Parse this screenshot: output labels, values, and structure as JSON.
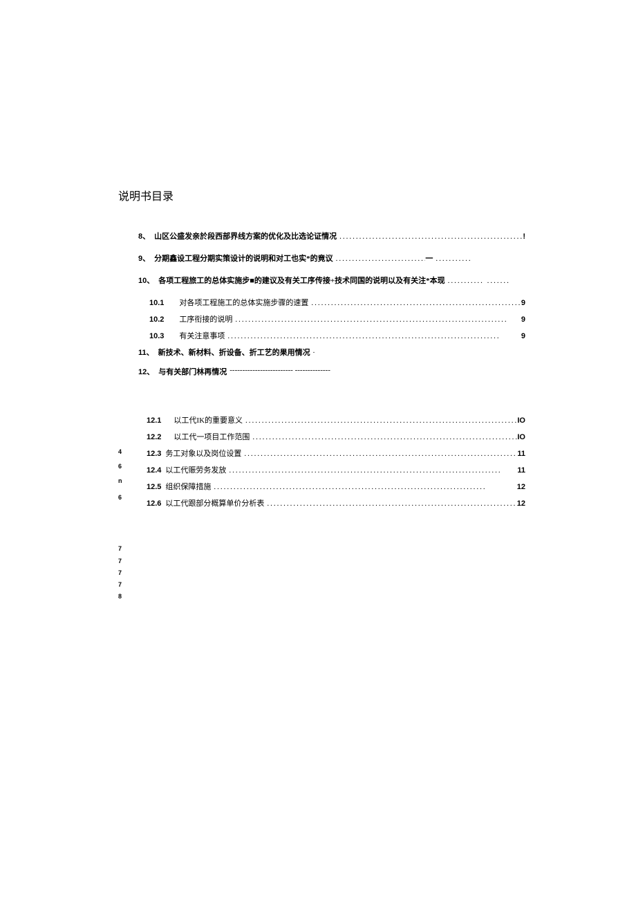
{
  "title": "说明书目录",
  "entries": {
    "e8": {
      "num": "8、",
      "label": "山区公盛发亲於段西部界线方案的优化及比选论证情况",
      "page": "!"
    },
    "e9": {
      "num": "9、",
      "label": "分期鑫设工程分期实策设计的说明和对工也实*的竟议",
      "page": ""
    },
    "e10": {
      "num": "10、",
      "label": "各项工程旅工的总体实施步■的建议及有关工序传接+技术同国的说明以及有关注*本现",
      "page": ""
    },
    "e10_1": {
      "num": "10.1",
      "label": "对各项工程施工的总体实施步骤的速置",
      "page": "9"
    },
    "e10_2": {
      "num": "10.2",
      "label": "工序衔接的说明",
      "page": "9"
    },
    "e10_3": {
      "num": "10.3",
      "label": "有关注意事项",
      "page": "9"
    },
    "e11": {
      "num": "11、",
      "label": "新技术、新材料、折设备、折工艺的果用情况",
      "page": ""
    },
    "e12": {
      "num": "12、",
      "label": "与有关部门林再情况",
      "page": ""
    },
    "e12_1": {
      "num": "12.1",
      "label": "以工代IK的重要意义",
      "page": "IO"
    },
    "e12_2": {
      "num": "12.2",
      "label": "以工代一项目工作范围",
      "page": "IO"
    },
    "e12_3": {
      "num": "12.3",
      "label": "务工对象以及岗位设置",
      "page": "11"
    },
    "e12_4": {
      "num": "12.4",
      "label": "以工代赈劳务发放",
      "page": "11"
    },
    "e12_5": {
      "num": "12.5",
      "label": "组织保障措施",
      "page": "12"
    },
    "e12_6": {
      "num": "12.6",
      "label": "以工代跟部分概算单价分析表",
      "page": "12"
    }
  },
  "leftNums": {
    "n1": "4",
    "n2": "6",
    "n3": "n",
    "n4": "6",
    "n5": "7",
    "n6": "7",
    "n7": "7",
    "n8": "7",
    "n9": "8"
  },
  "dots": "...................................................................................",
  "dotsShort": "................",
  "dashes": "------------------------- --------------",
  "dashMark": "一"
}
